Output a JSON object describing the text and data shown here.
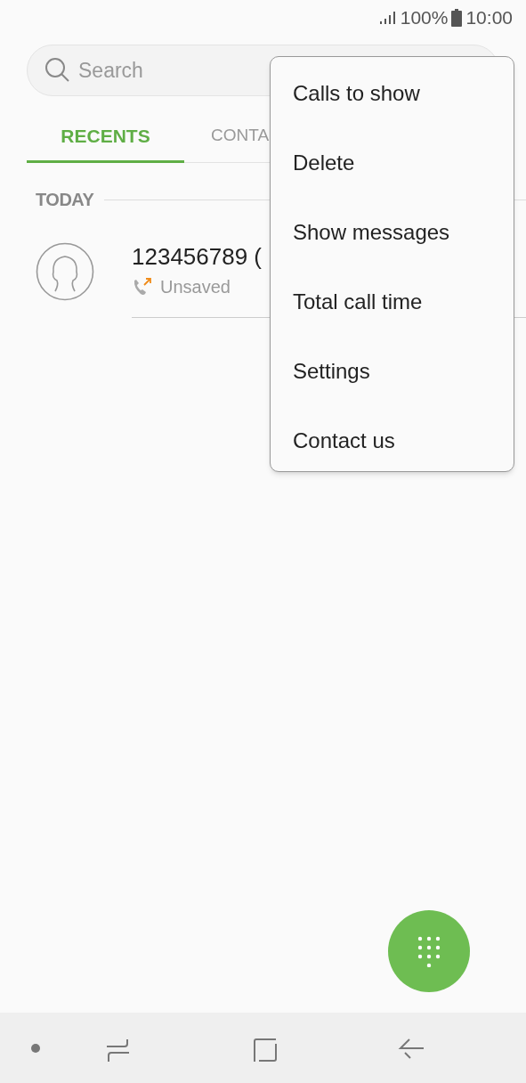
{
  "status_bar": {
    "battery": "100%",
    "time": "10:00"
  },
  "search": {
    "placeholder": "Search"
  },
  "tabs": [
    {
      "label": "RECENTS",
      "selected": true
    },
    {
      "label": "CONTA",
      "selected": false
    }
  ],
  "section": "TODAY",
  "calls": [
    {
      "number": "123456789 (",
      "label": "Unsaved"
    }
  ],
  "menu": [
    "Calls to show",
    "Delete",
    "Show messages",
    "Total call time",
    "Settings",
    "Contact us"
  ]
}
